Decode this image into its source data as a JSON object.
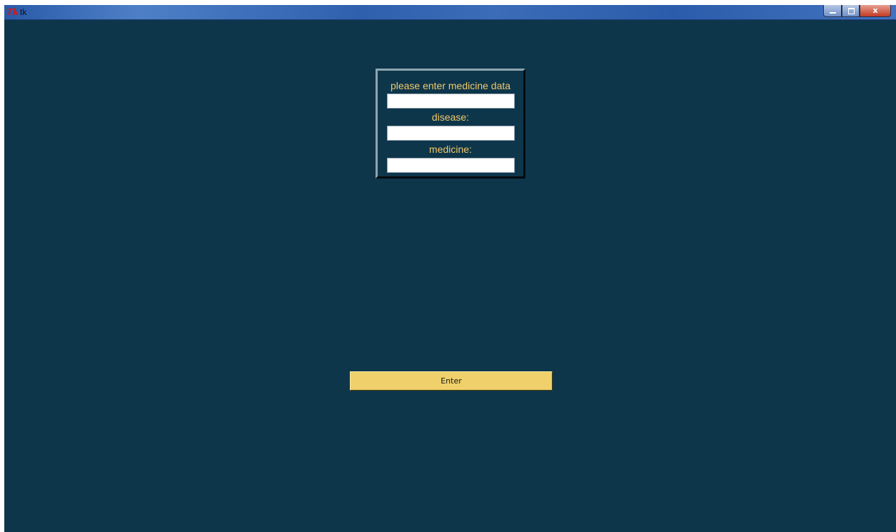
{
  "window": {
    "title": "tk",
    "icon": "tk-icon",
    "controls": {
      "minimize_icon": "minimize-icon",
      "maximize_icon": "maximize-icon",
      "close_icon": "close-icon",
      "close_glyph": "x"
    }
  },
  "form": {
    "heading": "please enter medicine data",
    "first_field_value": "",
    "disease_label": "disease:",
    "disease_value": "",
    "medicine_label": "medicine:",
    "medicine_value": ""
  },
  "actions": {
    "enter_label": "Enter"
  },
  "colors": {
    "background": "#0e364b",
    "label_text": "#f0c868",
    "button": "#f0d06a"
  }
}
